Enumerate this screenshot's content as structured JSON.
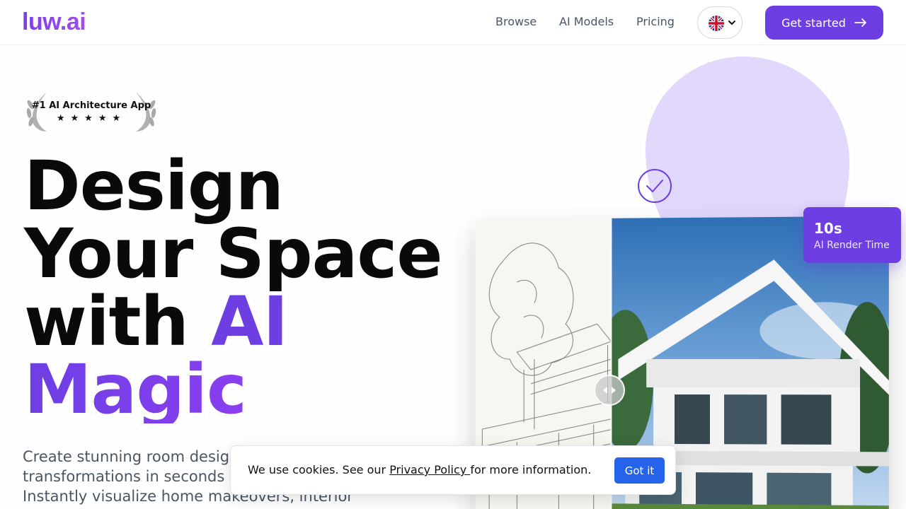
{
  "header": {
    "logo": "luw.ai",
    "nav": [
      "Browse",
      "AI Models",
      "Pricing"
    ],
    "language": "English",
    "cta_label": "Get started"
  },
  "award": {
    "text": "#1 AI Architecture App",
    "stars": "★★★★★",
    "rating": 5
  },
  "hero": {
    "line1": "Design",
    "line2": "Your Space",
    "line3_a": "with ",
    "line3_b": "AI",
    "line4": "Magic",
    "description": "Create stunning room designs and architectural transformations in seconds with our AI technology. Instantly visualize home makeovers, interior renovations,"
  },
  "stat": {
    "value": "10s",
    "label": "AI Render Time"
  },
  "cookie": {
    "text_before": "We use cookies. See our ",
    "link": "Privacy Policy ",
    "text_after": "for more information.",
    "button": "Got it"
  },
  "colors": {
    "brand": "#6d3fe3",
    "blob": "#e2d8fb",
    "cookie_button": "#2563eb"
  }
}
